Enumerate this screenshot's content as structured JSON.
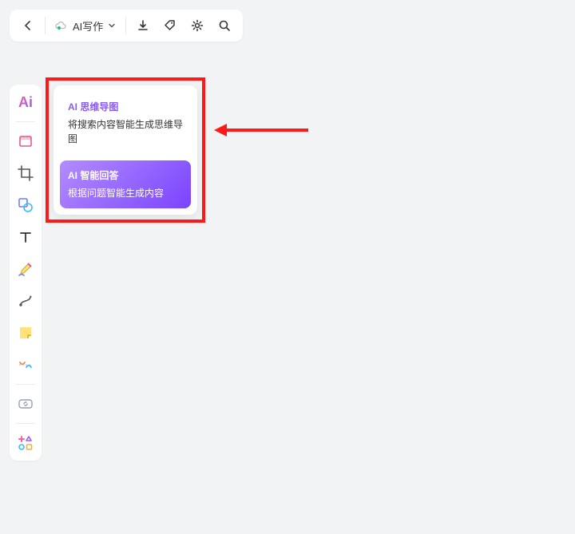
{
  "topbar": {
    "ai_write_label": "AI写作"
  },
  "rail": {
    "ai_label": "Ai"
  },
  "popup": {
    "card1": {
      "title": "AI 思维导图",
      "desc": "将搜索内容智能生成思维导图"
    },
    "card2": {
      "title": "AI 智能回答",
      "desc": "根据问题智能生成内容"
    }
  }
}
